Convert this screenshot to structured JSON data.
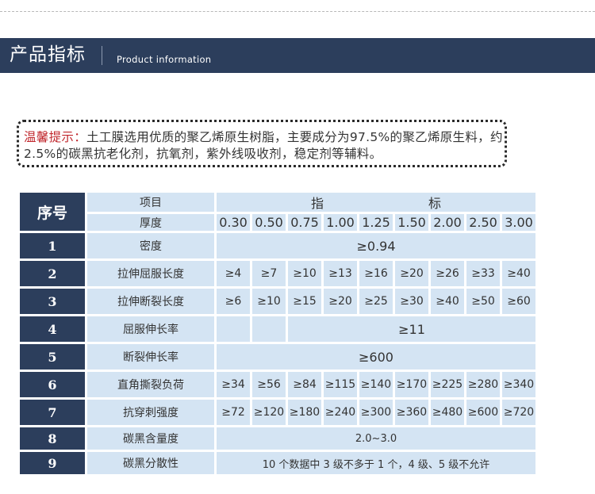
{
  "header": {
    "title": "产品指标",
    "subtitle": "Product information"
  },
  "tip": {
    "label": "温馨提示：",
    "text": "土工膜选用优质的聚乙烯原生树脂，主要成分为97.5%的聚乙烯原生料，约2.5%的碳黑抗老化剂，抗氧剂，紫外线吸收剂，稳定剂等辅料。"
  },
  "table": {
    "seq_header": "序号",
    "item_header": "项目",
    "index_header_1": "指",
    "index_header_2": "标",
    "thickness_label": "厚度",
    "thicknesses": [
      "0.30",
      "0.50",
      "0.75",
      "1.00",
      "1.25",
      "1.50",
      "2.00",
      "2.50",
      "3.00"
    ],
    "rows": [
      {
        "num": "1",
        "item": "密度",
        "span_value": "≥0.94"
      },
      {
        "num": "2",
        "item": "拉伸屈服长度",
        "values": [
          "≥4",
          "≥7",
          "≥10",
          "≥13",
          "≥16",
          "≥20",
          "≥26",
          "≥33",
          "≥40"
        ]
      },
      {
        "num": "3",
        "item": "拉伸断裂长度",
        "values": [
          "≥6",
          "≥10",
          "≥15",
          "≥20",
          "≥25",
          "≥30",
          "≥40",
          "≥50",
          "≥60"
        ]
      },
      {
        "num": "4",
        "item": "屈服伸长率",
        "span_value": "≥11"
      },
      {
        "num": "5",
        "item": "断裂伸长率",
        "span_value": "≥600"
      },
      {
        "num": "6",
        "item": "直角撕裂负荷",
        "values": [
          "≥34",
          "≥56",
          "≥84",
          "≥115",
          "≥140",
          "≥170",
          "≥225",
          "≥280",
          "≥340"
        ]
      },
      {
        "num": "7",
        "item": "抗穿刺强度",
        "values": [
          "≥72",
          "≥120",
          "≥180",
          "≥240",
          "≥300",
          "≥360",
          "≥480",
          "≥600",
          "≥720"
        ]
      },
      {
        "num": "8",
        "item": "碳黑含量度",
        "span_value": "2.0~3.0"
      },
      {
        "num": "9",
        "item": "碳黑分散性",
        "span_value": "10 个数据中 3 级不多于 1 个，4 级、5 级不允许"
      }
    ]
  }
}
